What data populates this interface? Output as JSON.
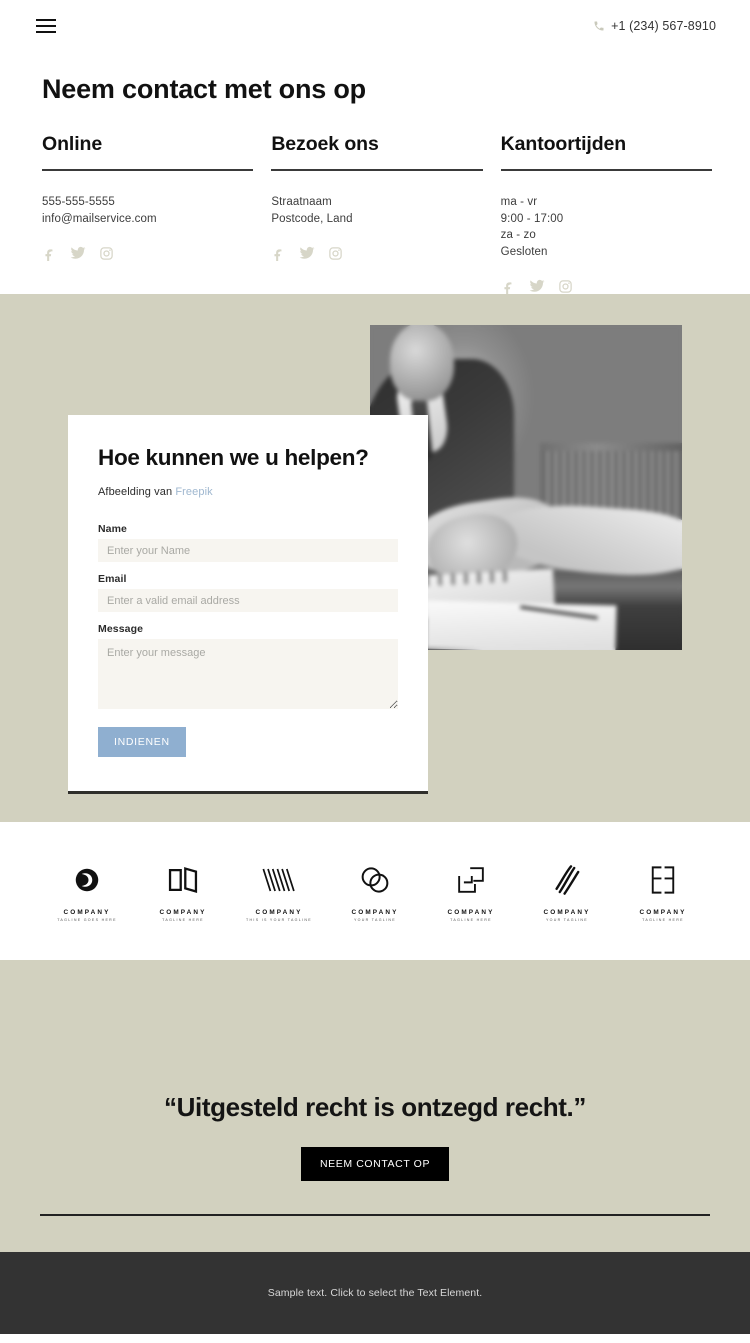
{
  "header": {
    "menu_icon": "hamburger-icon",
    "phone_icon": "phone-icon",
    "phone": "+1 (234) 567-8910"
  },
  "page_title": "Neem contact met ons op",
  "contact_columns": [
    {
      "title": "Online",
      "lines": [
        "555-555-5555",
        "info@mailservice.com"
      ],
      "socials": [
        "facebook-icon",
        "twitter-icon",
        "instagram-icon"
      ]
    },
    {
      "title": "Bezoek ons",
      "lines": [
        "Straatnaam",
        "Postcode, Land"
      ],
      "socials": [
        "facebook-icon",
        "twitter-icon",
        "instagram-icon"
      ]
    },
    {
      "title": "Kantoortijden",
      "lines": [
        "ma - vr",
        "9:00 - 17:00",
        "za - zo",
        "Gesloten"
      ],
      "socials": [
        "facebook-icon",
        "twitter-icon",
        "instagram-icon"
      ]
    }
  ],
  "form": {
    "title": "Hoe kunnen we u helpen?",
    "credit_prefix": "Afbeelding van ",
    "credit_link": "Freepik",
    "fields": [
      {
        "label": "Name",
        "placeholder": "Enter your Name"
      },
      {
        "label": "Email",
        "placeholder": "Enter a valid email address"
      },
      {
        "label": "Message",
        "placeholder": "Enter your message"
      }
    ],
    "submit_label": "INDIENEN",
    "submit_color": "#8fafd0"
  },
  "hero": {
    "photo_alt": "handshake-over-desk-photo"
  },
  "logos": [
    {
      "mark": "circle-swirl-mark",
      "name": "COMPANY",
      "tagline": "TAGLINE GOES HERE"
    },
    {
      "mark": "open-book-mark",
      "name": "COMPANY",
      "tagline": "TAGLINE HERE"
    },
    {
      "mark": "striped-v-mark",
      "name": "COMPANY",
      "tagline": "THIS IS YOUR TAGLINE"
    },
    {
      "mark": "overlapping-circles-mark",
      "name": "COMPANY",
      "tagline": "YOUR TAGLINE"
    },
    {
      "mark": "squares-arrow-mark",
      "name": "COMPANY",
      "tagline": "TAGLINE HERE"
    },
    {
      "mark": "diagonal-stripes-mark",
      "name": "COMPANY",
      "tagline": "YOUR TAGLINE"
    },
    {
      "mark": "mirrored-b-mark",
      "name": "COMPANY",
      "tagline": "TAGLINE HERE"
    }
  ],
  "quote": {
    "text": "“Uitgesteld recht is ontzegd recht.”",
    "button_label": "NEEM CONTACT OP"
  },
  "footer": {
    "text": "Sample text. Click to select the Text Element."
  },
  "colors": {
    "beige": "#d2d1bf",
    "dark": "#333333",
    "accent_blue": "#8fafd0",
    "link_blue": "#9fb7cf",
    "social_gray": "#d7d6c8"
  }
}
